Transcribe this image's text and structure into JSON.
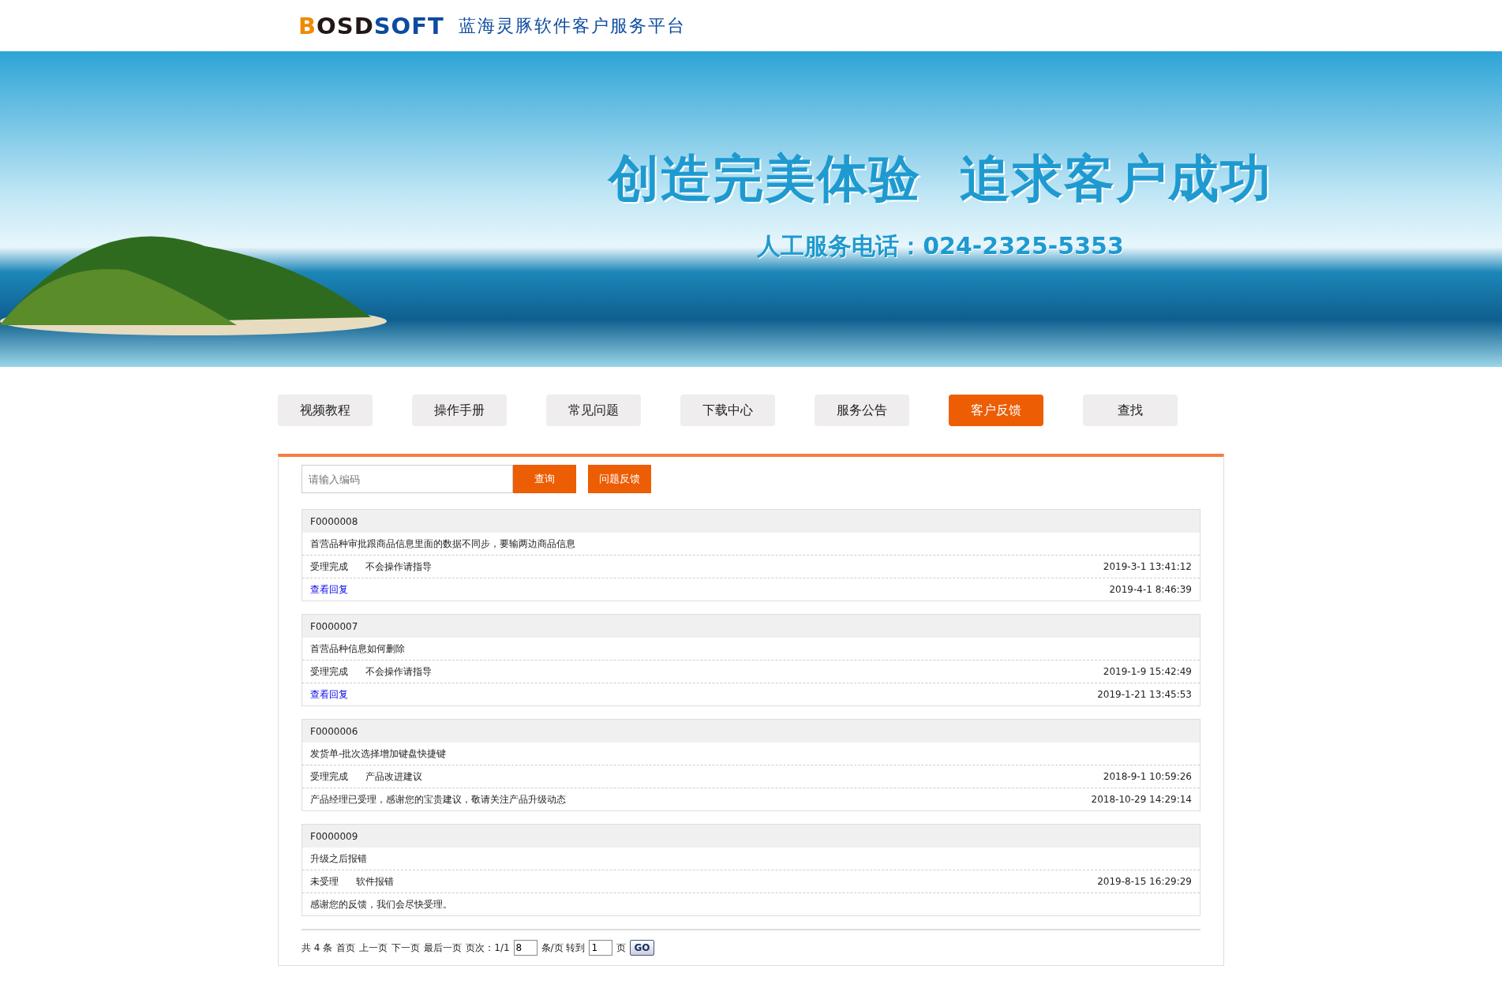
{
  "header": {
    "logo_parts": [
      "B",
      "OSD",
      "SOFT"
    ],
    "title": "蓝海灵豚软件客户服务平台"
  },
  "banner": {
    "headline": "创造完美体验  追求客户成功",
    "phone": "人工服务电话：024-2325-5353"
  },
  "nav": [
    {
      "label": "视频教程",
      "selected": false
    },
    {
      "label": "操作手册",
      "selected": false
    },
    {
      "label": "常见问题",
      "selected": false
    },
    {
      "label": "下载中心",
      "selected": false
    },
    {
      "label": "服务公告",
      "selected": false
    },
    {
      "label": "客户反馈",
      "selected": true
    },
    {
      "label": "查找",
      "selected": false
    }
  ],
  "search": {
    "placeholder": "请输入编码",
    "query_button": "查询",
    "feedback_button": "问题反馈"
  },
  "records": [
    {
      "code": "F0000008",
      "title": "首营品种审批跟商品信息里面的数据不同步，要输两边商品信息",
      "status": "受理完成",
      "category": "不会操作请指导",
      "date": "2019-3-1 13:41:12",
      "reply": {
        "kind": "link",
        "text": "查看回复",
        "date": "2019-4-1 8:46:39"
      }
    },
    {
      "code": "F0000007",
      "title": "首营品种信息如何删除",
      "status": "受理完成",
      "category": "不会操作请指导",
      "date": "2019-1-9 15:42:49",
      "reply": {
        "kind": "link",
        "text": "查看回复",
        "date": "2019-1-21 13:45:53"
      }
    },
    {
      "code": "F0000006",
      "title": "发货单-批次选择增加键盘快捷键",
      "status": "受理完成",
      "category": "产品改进建议",
      "date": "2018-9-1 10:59:26",
      "reply": {
        "kind": "text",
        "text": "产品经理已受理，感谢您的宝贵建议，敬请关注产品升级动态",
        "date": "2018-10-29 14:29:14"
      }
    },
    {
      "code": "F0000009",
      "title": "升级之后报错",
      "status": "未受理",
      "category": "软件报错",
      "date": "2019-8-15 16:29:29",
      "reply": {
        "kind": "text",
        "text": "感谢您的反馈，我们会尽快受理。"
      }
    }
  ],
  "pager": {
    "total": "共 4 条",
    "first": "首页",
    "prev": "上一页",
    "next": "下一页",
    "last": "最后一页",
    "page_info": "页次：1/1",
    "page_size": "8",
    "per_page": "条/页 转到",
    "goto_page": "1",
    "page_unit": "页",
    "go_button": "GO"
  }
}
